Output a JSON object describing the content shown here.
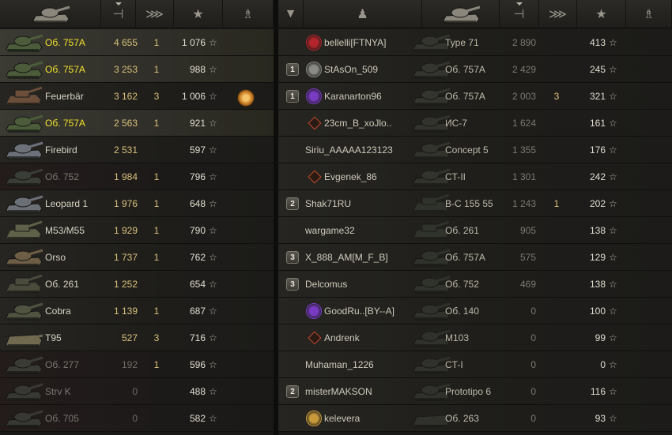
{
  "colors": {
    "self_name": "#f2e22b",
    "damage": "#d9c07a",
    "damage_low": "#6e6a63",
    "dead_name": "#7b7670"
  },
  "left": {
    "headers": [
      {
        "name": "tank-header-icon",
        "glyph": "",
        "sorted": false
      },
      {
        "name": "damage-header-icon",
        "glyph": "⊣",
        "sorted": true
      },
      {
        "name": "kills-header-icon",
        "glyph": "⋙",
        "sorted": false
      },
      {
        "name": "xp-header-icon",
        "glyph": "★",
        "sorted": false
      },
      {
        "name": "medal-header-icon",
        "glyph": "♗",
        "sorted": false
      }
    ],
    "rows": [
      {
        "tank": "Об. 757А",
        "damage": "4 655",
        "kills": "1",
        "xp": "1 076",
        "self": true,
        "dead": false,
        "icon": "heavy-tank-icon",
        "color": "#4c5b3a"
      },
      {
        "tank": "Об. 757А",
        "damage": "3 253",
        "kills": "1",
        "xp": "988",
        "self": true,
        "dead": false,
        "icon": "heavy-tank-icon",
        "color": "#4c5b3a"
      },
      {
        "tank": "Feuerbär",
        "damage": "3 162",
        "kills": "3",
        "xp": "1 006",
        "self": false,
        "dead": false,
        "icon": "spg-icon",
        "color": "#6b4e39",
        "medal": true
      },
      {
        "tank": "Об. 757А",
        "damage": "2 563",
        "kills": "1",
        "xp": "921",
        "self": true,
        "dead": false,
        "icon": "heavy-tank-icon",
        "color": "#4c5b3a"
      },
      {
        "tank": "Firebird",
        "damage": "2 531",
        "kills": "",
        "xp": "597",
        "self": false,
        "dead": false,
        "icon": "medium-tank-icon",
        "color": "#6c7079"
      },
      {
        "tank": "Об. 752",
        "damage": "1 984",
        "kills": "1",
        "xp": "796",
        "self": false,
        "dead": true,
        "icon": "heavy-tank-icon",
        "color": "#3a3c36"
      },
      {
        "tank": "Leopard 1",
        "damage": "1 976",
        "kills": "1",
        "xp": "648",
        "self": false,
        "dead": false,
        "icon": "medium-tank-icon",
        "color": "#6b6f76"
      },
      {
        "tank": "M53/M55",
        "damage": "1 929",
        "kills": "1",
        "xp": "790",
        "self": false,
        "dead": false,
        "icon": "spg-icon",
        "color": "#5f6148"
      },
      {
        "tank": "Orso",
        "damage": "1 737",
        "kills": "1",
        "xp": "762",
        "self": false,
        "dead": false,
        "icon": "medium-tank-icon",
        "color": "#6c5d44"
      },
      {
        "tank": "Об. 261",
        "damage": "1 252",
        "kills": "",
        "xp": "654",
        "self": false,
        "dead": false,
        "icon": "spg-icon",
        "color": "#4a4b3c"
      },
      {
        "tank": "Cobra",
        "damage": "1 139",
        "kills": "1",
        "xp": "687",
        "self": false,
        "dead": false,
        "icon": "medium-tank-icon",
        "color": "#4f5340"
      },
      {
        "tank": "T95",
        "damage": "527",
        "kills": "3",
        "xp": "716",
        "self": false,
        "dead": false,
        "icon": "td-icon",
        "color": "#706950"
      },
      {
        "tank": "Об. 277",
        "damage": "192",
        "kills": "1",
        "xp": "596",
        "self": false,
        "dead": true,
        "icon": "heavy-tank-icon",
        "color": "#3a3b35",
        "grey": true
      },
      {
        "tank": "Strv K",
        "damage": "0",
        "kills": "",
        "xp": "488",
        "self": false,
        "dead": true,
        "icon": "heavy-tank-icon",
        "color": "#373834",
        "grey": true
      },
      {
        "tank": "Об. 705",
        "damage": "0",
        "kills": "",
        "xp": "582",
        "self": false,
        "dead": true,
        "icon": "heavy-tank-icon",
        "color": "#373834",
        "grey": true
      }
    ]
  },
  "right": {
    "headers": [
      {
        "name": "platoon-header-icon",
        "glyph": "▼",
        "sorted": false
      },
      {
        "name": "player-header-icon",
        "glyph": "♟",
        "sorted": false
      },
      {
        "name": "tank-header-icon",
        "glyph": "",
        "sorted": false
      },
      {
        "name": "damage-header-icon",
        "glyph": "⊣",
        "sorted": true
      },
      {
        "name": "kills-header-icon",
        "glyph": "⋙",
        "sorted": false
      },
      {
        "name": "xp-header-icon",
        "glyph": "★",
        "sorted": false
      },
      {
        "name": "medal-header-icon",
        "glyph": "♗",
        "sorted": false
      }
    ],
    "rows": [
      {
        "platoon": "",
        "clan": "clan-red",
        "player": "bellelli[FTNYA]",
        "tank": "Type 71",
        "damage": "2 890",
        "kills": "",
        "xp": "413",
        "icon": "heavy-tank-icon",
        "color": "#3a3b35"
      },
      {
        "platoon": "1",
        "clan": "clan-skull",
        "player": "StAsOn_509",
        "tank": "Об. 757А",
        "damage": "2 429",
        "kills": "",
        "xp": "245",
        "icon": "heavy-tank-icon",
        "color": "#3a3c34"
      },
      {
        "platoon": "1",
        "clan": "clan-purple",
        "player": "Karanarton96",
        "tank": "Об. 757А",
        "damage": "2 003",
        "kills": "3",
        "xp": "321",
        "icon": "heavy-tank-icon",
        "color": "#3a3c34"
      },
      {
        "platoon": "",
        "clan": "rank-diamond",
        "player": "23cm_B_xoJlo..",
        "tank": "ИС-7",
        "damage": "1 624",
        "kills": "",
        "xp": "161",
        "icon": "heavy-tank-icon",
        "color": "#383a33"
      },
      {
        "platoon": "",
        "clan": "",
        "player": "Siriu_AAAAA123123",
        "tank": "Concept 5",
        "damage": "1 355",
        "kills": "",
        "xp": "176",
        "icon": "medium-tank-icon",
        "color": "#383a33"
      },
      {
        "platoon": "",
        "clan": "rank-diamond",
        "player": "Evgenek_86",
        "tank": "CT-II",
        "damage": "1 301",
        "kills": "",
        "xp": "242",
        "icon": "heavy-tank-icon",
        "color": "#383a33"
      },
      {
        "platoon": "2",
        "clan": "",
        "player": "Shak71RU",
        "tank": "B-C 155 55",
        "damage": "1 243",
        "kills": "1",
        "xp": "202",
        "icon": "spg-icon",
        "color": "#363832"
      },
      {
        "platoon": "",
        "clan": "",
        "player": "wargame32",
        "tank": "Об. 261",
        "damage": "905",
        "kills": "",
        "xp": "138",
        "icon": "spg-icon",
        "color": "#363832"
      },
      {
        "platoon": "3",
        "clan": "",
        "player": "X_888_AM[M_F_B]",
        "tank": "Об. 757А",
        "damage": "575",
        "kills": "",
        "xp": "129",
        "icon": "heavy-tank-icon",
        "color": "#363832"
      },
      {
        "platoon": "3",
        "clan": "",
        "player": "Delcomus",
        "tank": "Об. 752",
        "damage": "469",
        "kills": "",
        "xp": "138",
        "icon": "heavy-tank-icon",
        "color": "#363832"
      },
      {
        "platoon": "",
        "clan": "clan-purple",
        "player": "GoodRu..[BY--A]",
        "tank": "Об. 140",
        "damage": "0",
        "kills": "",
        "xp": "100",
        "icon": "medium-tank-icon",
        "color": "#353731"
      },
      {
        "platoon": "",
        "clan": "rank-diamond",
        "player": "Andrenk",
        "tank": "M103",
        "damage": "0",
        "kills": "",
        "xp": "99",
        "icon": "heavy-tank-icon",
        "color": "#353731"
      },
      {
        "platoon": "",
        "clan": "",
        "player": "Muhaman_1226",
        "tank": "CT-I",
        "damage": "0",
        "kills": "",
        "xp": "0",
        "icon": "heavy-tank-icon",
        "color": "#353731"
      },
      {
        "platoon": "2",
        "clan": "",
        "player": "misterMAKSON",
        "tank": "Prototipo 6",
        "damage": "0",
        "kills": "",
        "xp": "116",
        "icon": "medium-tank-icon",
        "color": "#353731"
      },
      {
        "platoon": "",
        "clan": "clan-gold",
        "player": "kelevera",
        "tank": "Об. 263",
        "damage": "0",
        "kills": "",
        "xp": "93",
        "icon": "td-icon",
        "color": "#353731"
      }
    ]
  }
}
